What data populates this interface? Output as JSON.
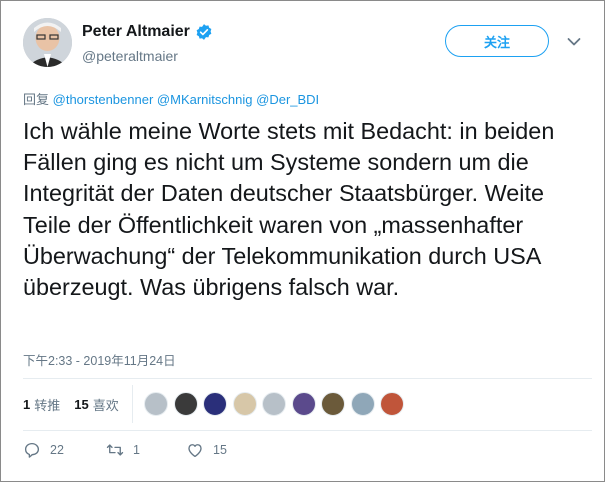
{
  "author": {
    "display_name": "Peter Altmaier",
    "handle": "@peteraltmaier"
  },
  "follow_button": {
    "label": "关注"
  },
  "reply_context": {
    "prefix": "回复",
    "mentions": [
      "@thorstenbenner",
      "@MKarnitschnig",
      "@Der_BDI"
    ]
  },
  "tweet": {
    "text": "Ich wähle meine Worte stets mit Bedacht: in beiden Fällen ging es nicht um Systeme sondern um die Integrität der Daten deutscher Staatsbürger. Weite Teile der Öffentlichkeit waren von „massenhafter Überwachung“ der Telekommunikation durch USA überzeugt. Was übrigens falsch war.",
    "timestamp": "下午2:33 - 2019年11月24日"
  },
  "stats": {
    "retweets_count": "1",
    "retweets_label": "转推",
    "likes_count": "15",
    "likes_label": "喜欢"
  },
  "likers": [
    {
      "name": "liker-1",
      "color": "#b7c0c8"
    },
    {
      "name": "liker-2",
      "color": "#3a3a3a"
    },
    {
      "name": "liker-3",
      "color": "#2a2f7a"
    },
    {
      "name": "liker-4",
      "color": "#d7c7a8"
    },
    {
      "name": "liker-5",
      "color": "#b7c0c8"
    },
    {
      "name": "liker-6",
      "color": "#5b4a8c"
    },
    {
      "name": "liker-7",
      "color": "#6b5a3a"
    },
    {
      "name": "liker-8",
      "color": "#8fa7b8"
    },
    {
      "name": "liker-9",
      "color": "#c0553a"
    }
  ],
  "actions": {
    "reply_count": "22",
    "retweet_count": "1",
    "like_count": "15"
  },
  "colors": {
    "accent": "#1da1f2",
    "link": "#1b95e0",
    "muted": "#657786",
    "verified": "#1da1f2"
  }
}
